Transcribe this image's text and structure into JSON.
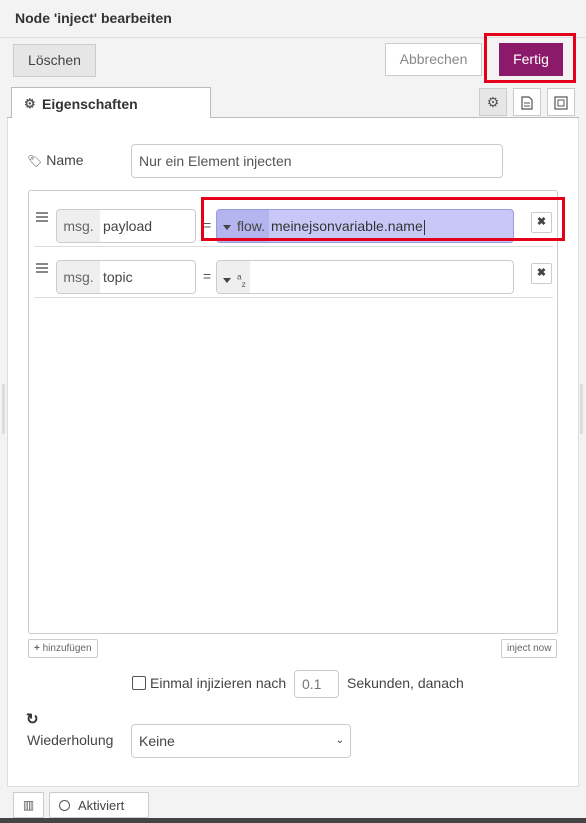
{
  "header": {
    "title": "Node 'inject' bearbeiten"
  },
  "toolbar": {
    "delete_label": "Löschen",
    "cancel_label": "Abbrechen",
    "done_label": "Fertig"
  },
  "tabs": {
    "properties_label": "Eigenschaften",
    "icons": [
      "gear-icon",
      "document-icon",
      "layout-icon"
    ]
  },
  "form": {
    "name_label": "Name",
    "name_value": "Nur ein Element injecten"
  },
  "properties": [
    {
      "prefix": "msg.",
      "key": "payload",
      "type": "flow.",
      "value": "meinejsonvariable.name"
    },
    {
      "prefix": "msg.",
      "key": "topic",
      "type_icon": "a",
      "type_icon_sub": "z",
      "value": ""
    }
  ],
  "list_actions": {
    "add_label": "hinzufügen",
    "inject_label": "inject now"
  },
  "once": {
    "label": "Einmal injizieren nach",
    "seconds_placeholder": "0.1",
    "seconds_suffix": "Sekunden, danach"
  },
  "repeat": {
    "label": "Wiederholung",
    "selected": "Keine"
  },
  "footer": {
    "status_label": "Aktiviert"
  },
  "colors": {
    "accent": "#8c1a6a",
    "highlight": "#e4001b",
    "selection": "#c8c8f8"
  }
}
